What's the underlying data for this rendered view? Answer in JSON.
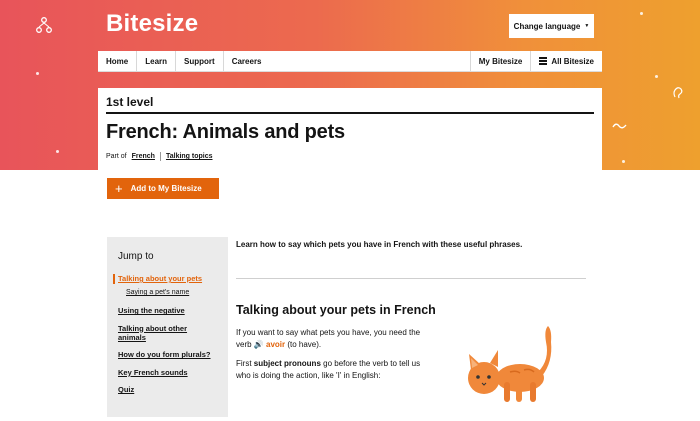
{
  "header": {
    "brand": "Bitesize",
    "change_language": "Change language",
    "colors": {
      "gradient_start": "#e8545a",
      "gradient_end": "#eea02e",
      "accent": "#e2640c"
    }
  },
  "nav": {
    "left": [
      "Home",
      "Learn",
      "Support",
      "Careers"
    ],
    "my_bitesize": "My Bitesize",
    "all_bitesize": "All Bitesize"
  },
  "guide": {
    "level": "1st level",
    "title": "French: Animals and pets",
    "part_of_label": "Part of",
    "part_of_links": [
      "French",
      "Talking topics"
    ],
    "add_button": "Add to My Bitesize",
    "add_icon": "plus-icon"
  },
  "jump_to": {
    "title": "Jump to",
    "items": [
      {
        "label": "Talking about your pets",
        "active": true,
        "sub": false
      },
      {
        "label": "Saying a pet's name",
        "active": false,
        "sub": true
      },
      {
        "label": "Using the negative",
        "active": false,
        "sub": false
      },
      {
        "label": "Talking about other animals",
        "active": false,
        "sub": false
      },
      {
        "label": "How do you form plurals?",
        "active": false,
        "sub": false
      },
      {
        "label": "Key French sounds",
        "active": false,
        "sub": false
      },
      {
        "label": "Quiz",
        "active": false,
        "sub": false
      }
    ]
  },
  "article": {
    "lead": "Learn how to say which pets you have in French with these useful phrases.",
    "section_heading": "Talking about your pets in French",
    "para1_before": "If you want to say what pets you have, you need the verb ",
    "para1_word": "avoir",
    "para1_after": " (to have).",
    "para2_before": "First ",
    "para2_bold": "subject pronouns",
    "para2_after": " go before the verb to tell us who is doing the action, like 'I' in English:",
    "illustration": "orange-cat-illustration"
  }
}
